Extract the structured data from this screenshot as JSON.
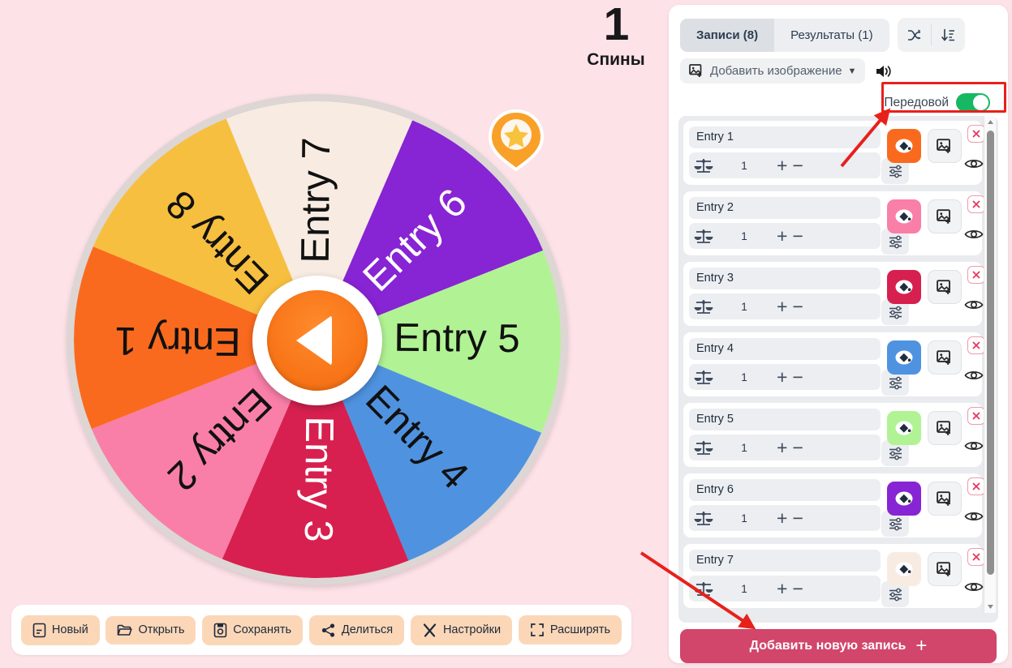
{
  "background_color": "#fde2e8",
  "spins": {
    "count": "1",
    "label": "Спины"
  },
  "wheel": {
    "segments": [
      {
        "label": "Entry 1",
        "color": "#fa6a1e",
        "text_color": "#111111"
      },
      {
        "label": "Entry 2",
        "color": "#f97fa8",
        "text_color": "#111111"
      },
      {
        "label": "Entry 3",
        "color": "#d7204f",
        "text_color": "#ffffff"
      },
      {
        "label": "Entry 4",
        "color": "#4f93e0",
        "text_color": "#111111"
      },
      {
        "label": "Entry 5",
        "color": "#b1f394",
        "text_color": "#111111"
      },
      {
        "label": "Entry 6",
        "color": "#8724d4",
        "text_color": "#ffffff"
      },
      {
        "label": "Entry 7",
        "color": "#f8ece2",
        "text_color": "#111111"
      },
      {
        "label": "Entry 8",
        "color": "#f7bf3f",
        "text_color": "#111111"
      }
    ],
    "rim_color": "#ddd6d4",
    "hub_color": "#f87518",
    "pointer_color": "#f9a029",
    "pointer_icon": "star"
  },
  "toolbar": {
    "buttons": [
      {
        "label": "Новый",
        "icon": "new-file-icon"
      },
      {
        "label": "Открыть",
        "icon": "folder-open-icon"
      },
      {
        "label": "Сохранять",
        "icon": "save-disk-icon"
      },
      {
        "label": "Делиться",
        "icon": "share-icon"
      },
      {
        "label": "Настройки",
        "icon": "tools-icon"
      },
      {
        "label": "Расширять",
        "icon": "expand-icon"
      }
    ],
    "button_bg": "#fbd7b8"
  },
  "panel": {
    "tabs": [
      {
        "label": "Записи (8)",
        "active": true
      },
      {
        "label": "Результаты (1)",
        "active": false
      }
    ],
    "tools": [
      {
        "icon": "shuffle-icon",
        "name": "shuffle-button"
      },
      {
        "icon": "sort-descending-icon",
        "name": "sort-button"
      }
    ],
    "add_image": {
      "label": "Добавить изображение",
      "caret": "▼",
      "icon": "image-add-icon"
    },
    "sound_icon": "speaker-icon",
    "advanced": {
      "label": "Передовой",
      "enabled": true,
      "toggle_color": "#17b862"
    },
    "entries": [
      {
        "name": "Entry 1",
        "weight": "1",
        "color": "#fa6a1e"
      },
      {
        "name": "Entry 2",
        "weight": "1",
        "color": "#f97fa8"
      },
      {
        "name": "Entry 3",
        "weight": "1",
        "color": "#d7204f"
      },
      {
        "name": "Entry 4",
        "weight": "1",
        "color": "#4f93e0"
      },
      {
        "name": "Entry 5",
        "weight": "1",
        "color": "#b1f394"
      },
      {
        "name": "Entry 6",
        "weight": "1",
        "color": "#8724d4"
      },
      {
        "name": "Entry 7",
        "weight": "1",
        "color": "#f8ece2"
      }
    ],
    "entry_icons": {
      "weight": "balance-scale-icon",
      "plus": "+",
      "minus": "−",
      "sliders": "sliders-icon",
      "color": "paint-bucket-icon",
      "image": "image-add-icon",
      "delete": "close-x-icon",
      "visibility": "eye-icon"
    },
    "add_entry": {
      "label": "Добавить новую запись",
      "plus": "+",
      "color": "#d1466a"
    }
  },
  "annotations": {
    "highlight_color": "#e8201b",
    "arrows": [
      {
        "name": "arrow-to-advanced-toggle"
      },
      {
        "name": "arrow-to-add-entry-button"
      }
    ]
  }
}
